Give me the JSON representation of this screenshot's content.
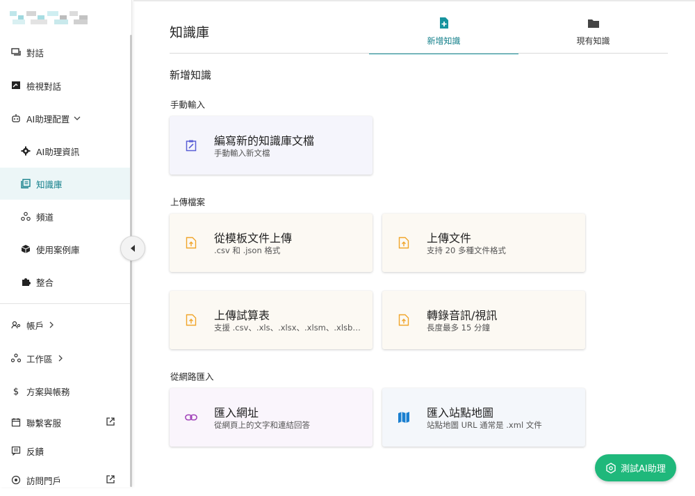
{
  "sidebar": {
    "items": [
      {
        "label": "對話",
        "icon": "chat-bubble-icon"
      },
      {
        "label": "檢視對話",
        "icon": "review-chat-icon"
      },
      {
        "label": "AI助理配置",
        "icon": "robot-icon"
      },
      {
        "label": "AI助理資訊",
        "icon": "gear-icon"
      },
      {
        "label": "知識庫",
        "icon": "library-icon"
      },
      {
        "label": "頻道",
        "icon": "channels-icon"
      },
      {
        "label": "使用案例庫",
        "icon": "box-icon"
      },
      {
        "label": "整合",
        "icon": "puzzle-icon"
      },
      {
        "label": "帳戶",
        "icon": "account-icon"
      },
      {
        "label": "工作區",
        "icon": "workspace-icon"
      },
      {
        "label": "方案與帳務",
        "icon": "dollar-icon"
      },
      {
        "label": "聯繫客服",
        "icon": "support-icon"
      },
      {
        "label": "反饋",
        "icon": "feedback-icon"
      },
      {
        "label": "訪問門戶",
        "icon": "portal-icon"
      }
    ]
  },
  "main": {
    "title": "知識庫",
    "tabs": [
      {
        "label": "新增知識",
        "icon": "file-plus-icon",
        "active": true
      },
      {
        "label": "現有知識",
        "icon": "folder-icon",
        "active": false
      }
    ],
    "section_title": "新增知識",
    "groups": [
      {
        "label": "手動輸入"
      },
      {
        "label": "上傳檔案"
      },
      {
        "label": "從網路匯入"
      }
    ],
    "cards": [
      {
        "title": "編寫新的知識庫文檔",
        "subtitle": "手動輸入新文檔",
        "icon": "edit-clipboard-icon"
      },
      {
        "title": "從模板文件上傳",
        "subtitle": ".csv 和 .json 格式",
        "icon": "upload-file-icon"
      },
      {
        "title": "上傳文件",
        "subtitle": "支持 20 多種文件格式",
        "icon": "upload-file-icon"
      },
      {
        "title": "上傳試算表",
        "subtitle": "支援 .csv、.xls、.xlsx、.xlsm、.xlsb、.ods",
        "icon": "upload-file-icon"
      },
      {
        "title": "轉錄音訊/視訊",
        "subtitle": "長度最多 15 分鐘",
        "icon": "upload-file-icon"
      },
      {
        "title": "匯入網址",
        "subtitle": "從網頁上的文字和連結回答",
        "icon": "link-icon"
      },
      {
        "title": "匯入站點地圖",
        "subtitle": "站點地圖 URL 通常是 .xml 文件",
        "icon": "map-icon"
      }
    ]
  },
  "test_button": {
    "label": "測試AI助理",
    "icon": "assistant-icon"
  },
  "colors": {
    "accent": "#127f8a",
    "active_bg": "#ecf6f7",
    "cta": "#1fb87b",
    "upload_icon": "#f0a52a",
    "manual_icon": "#5a5fd6",
    "link_icon": "#a040b8",
    "map_icon": "#1a7fd0"
  }
}
